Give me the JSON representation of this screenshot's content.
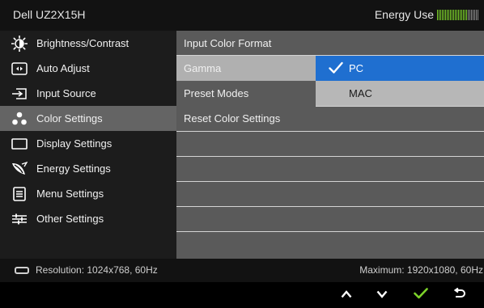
{
  "header": {
    "title": "Dell UZ2X15H",
    "energy_label": "Energy Use",
    "energy_level": 0.72
  },
  "sidebar": {
    "items": [
      {
        "label": "Brightness/Contrast",
        "icon": "sun-icon",
        "selected": false
      },
      {
        "label": "Auto Adjust",
        "icon": "auto-adjust-icon",
        "selected": false
      },
      {
        "label": "Input Source",
        "icon": "input-source-icon",
        "selected": false
      },
      {
        "label": "Color Settings",
        "icon": "color-dots-icon",
        "selected": true
      },
      {
        "label": "Display Settings",
        "icon": "display-icon",
        "selected": false
      },
      {
        "label": "Energy Settings",
        "icon": "leaf-icon",
        "selected": false
      },
      {
        "label": "Menu Settings",
        "icon": "menu-icon",
        "selected": false
      },
      {
        "label": "Other Settings",
        "icon": "sliders-icon",
        "selected": false
      }
    ]
  },
  "submenu": {
    "rows": [
      {
        "label": "Input Color Format"
      },
      {
        "label": "Gamma"
      },
      {
        "label": "Preset Modes"
      },
      {
        "label": "Reset Color Settings"
      }
    ],
    "gamma_options": [
      {
        "label": "PC",
        "checked": true
      },
      {
        "label": "MAC",
        "checked": false
      }
    ]
  },
  "status": {
    "resolution": "Resolution: 1024x768, 60Hz",
    "maximum": "Maximum: 1920x1080, 60Hz"
  },
  "buttons": [
    "up-arrow-icon",
    "down-arrow-icon",
    "check-icon",
    "back-icon"
  ],
  "colors": {
    "accent_green": "#7dd32a",
    "selected_bg": "#646464",
    "option_highlight": "#1f6fd0"
  }
}
